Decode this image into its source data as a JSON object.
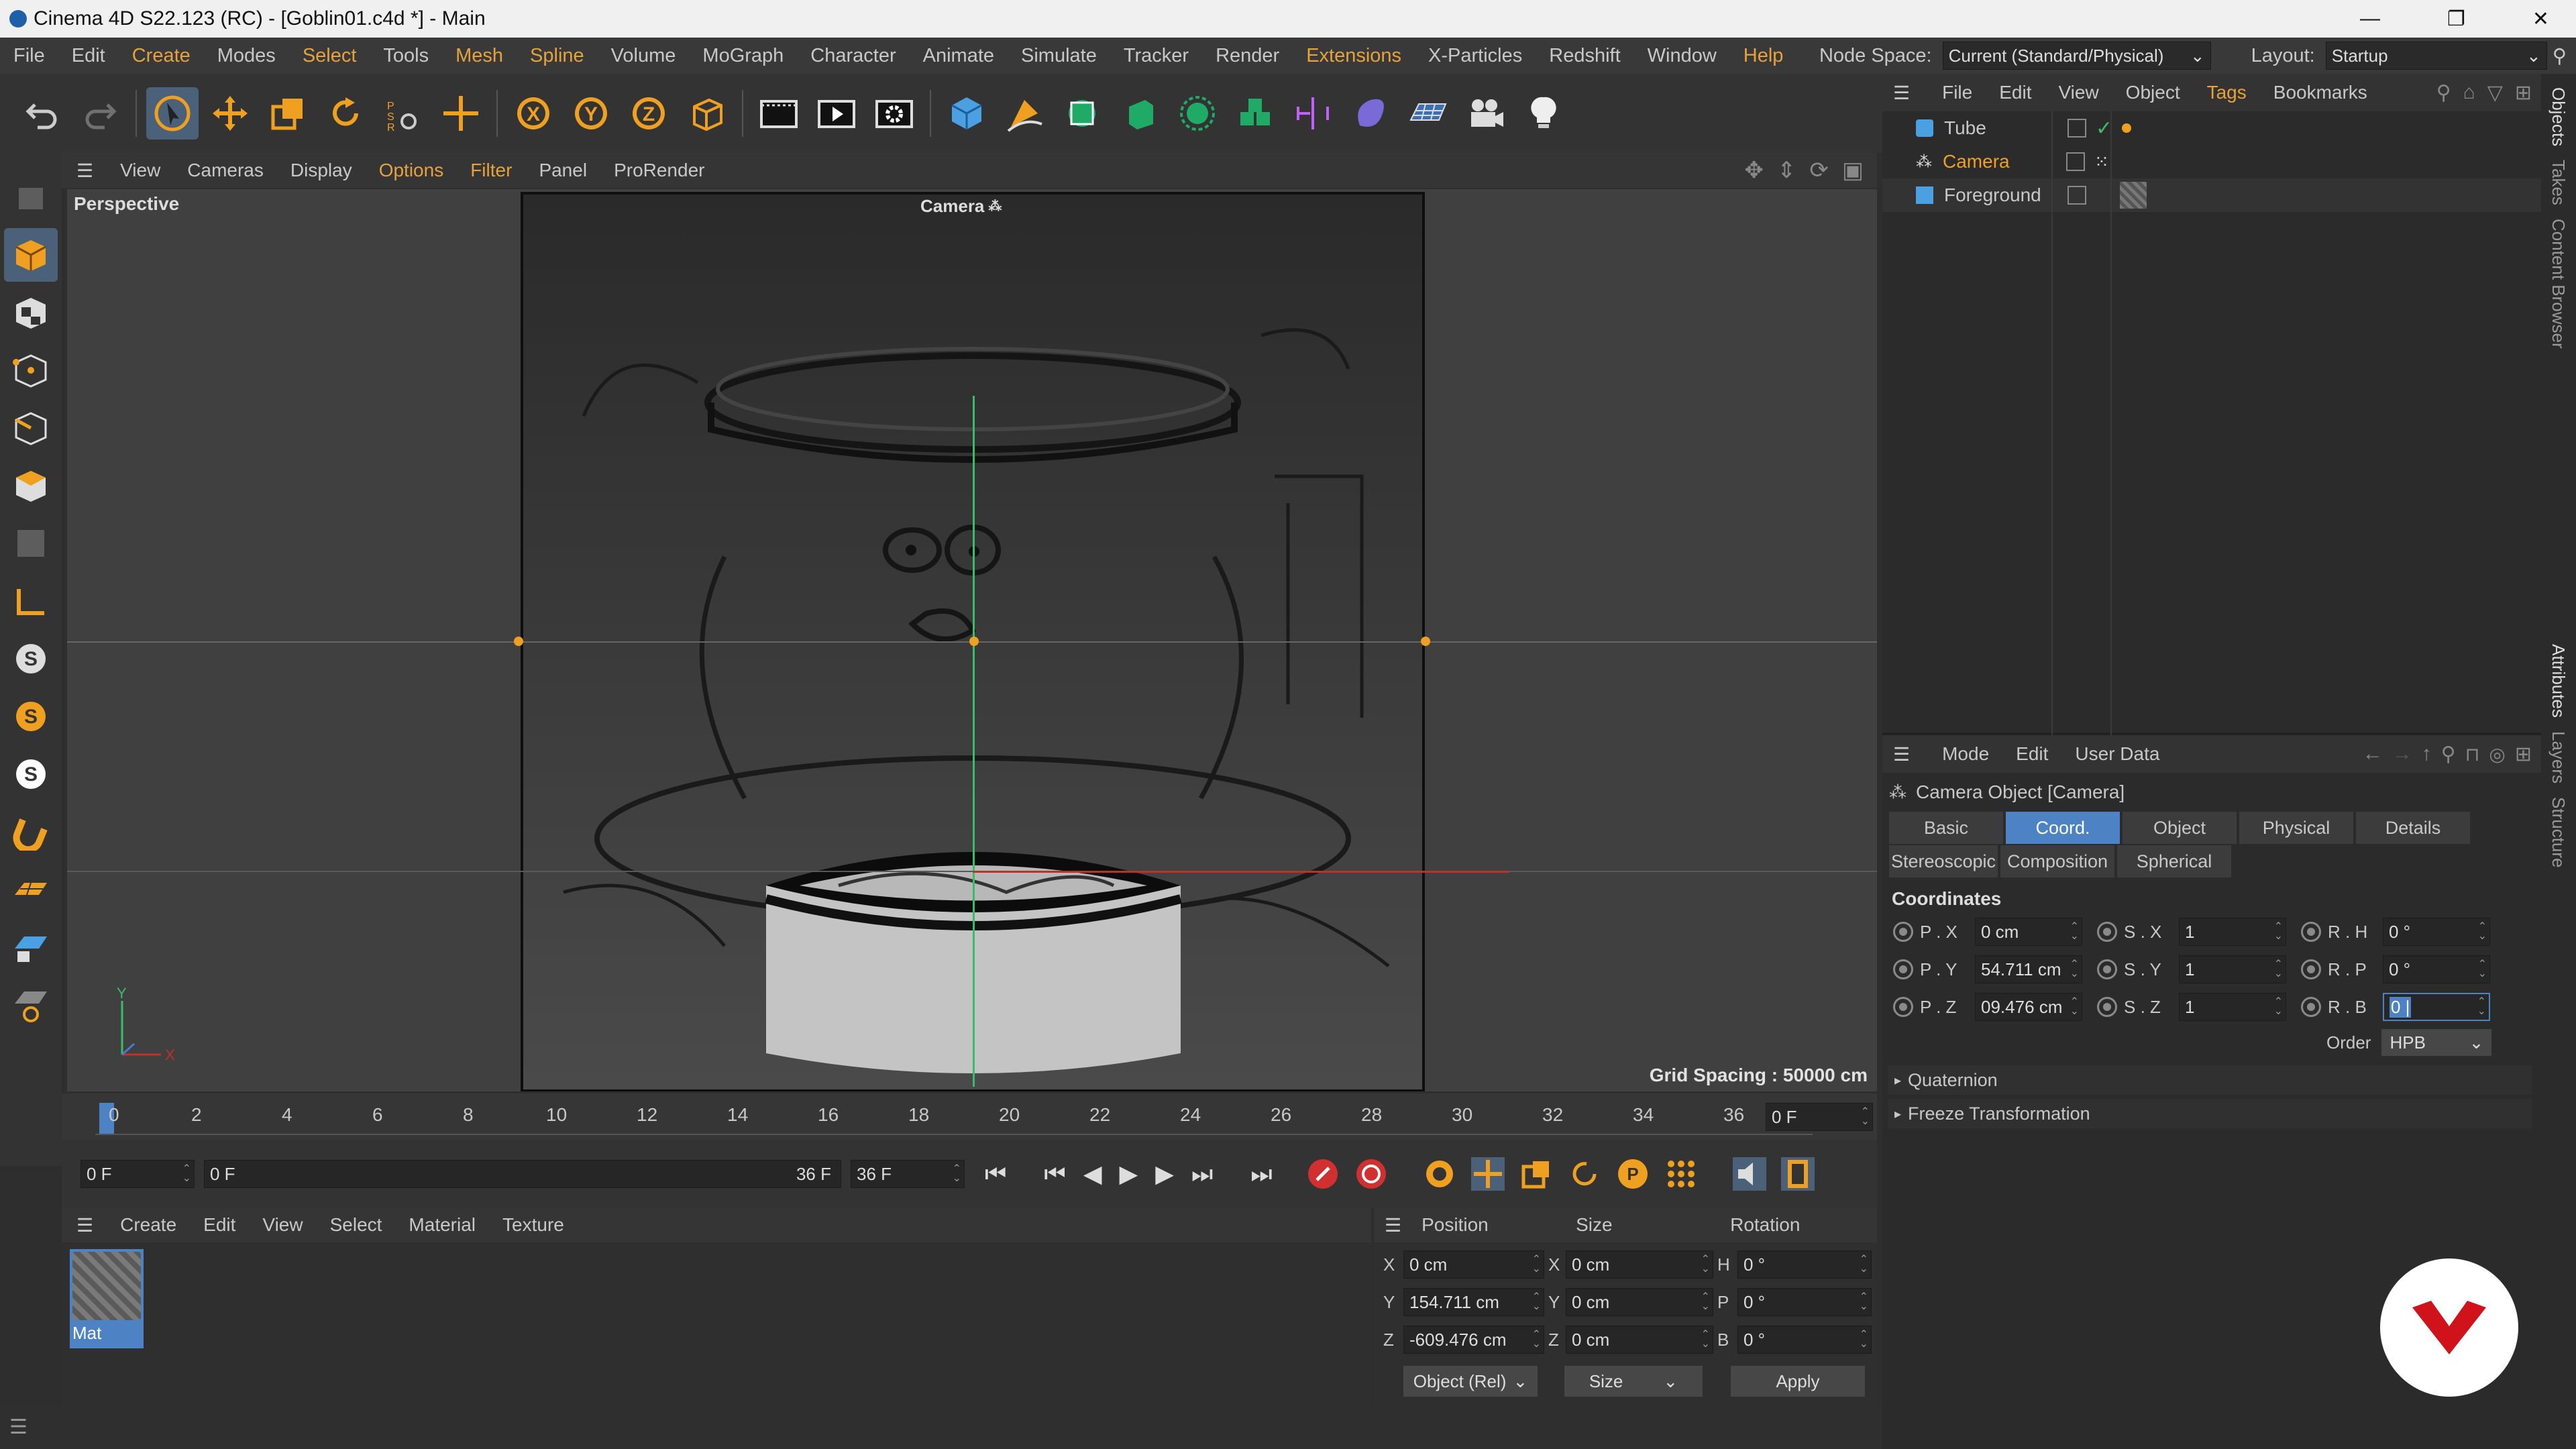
{
  "titlebar": {
    "title": "Cinema 4D S22.123 (RC) - [Goblin01.c4d *] - Main",
    "min": "—",
    "max": "❐",
    "close": "✕"
  },
  "menu": {
    "items": [
      "File",
      "Edit",
      "Create",
      "Modes",
      "Select",
      "Tools",
      "Mesh",
      "Spline",
      "Volume",
      "MoGraph",
      "Character",
      "Animate",
      "Simulate",
      "Tracker",
      "Render",
      "Extensions",
      "X-Particles",
      "Redshift",
      "Window",
      "Help"
    ],
    "node_space_label": "Node Space:",
    "node_space_value": "Current (Standard/Physical)",
    "layout_label": "Layout:",
    "layout_value": "Startup"
  },
  "toolbar": {
    "icons": [
      "undo-icon",
      "redo-icon",
      "select-icon",
      "move-icon",
      "scale-icon",
      "rotate-icon",
      "psr-icon",
      "world-axis-icon",
      "x-axis-icon",
      "y-axis-icon",
      "z-axis-icon",
      "coordinate-system-icon",
      "render-view-icon",
      "render-picture-viewer-icon",
      "render-settings-icon",
      "cube-icon",
      "pen-icon",
      "subdivision-icon",
      "extrude-icon",
      "cloner-icon",
      "instance-icon",
      "symmetry-icon",
      "deformer-icon",
      "floor-icon",
      "camera-icon",
      "light-icon"
    ]
  },
  "viewport": {
    "menu": [
      "View",
      "Cameras",
      "Display",
      "Options",
      "Filter",
      "Panel",
      "ProRender"
    ],
    "label": "Perspective",
    "camera_label": "Camera",
    "grid_spacing": "Grid Spacing : 50000 cm",
    "axis_x": "X",
    "axis_y": "Y"
  },
  "timeline": {
    "ticks": [
      "0",
      "2",
      "4",
      "6",
      "8",
      "10",
      "12",
      "14",
      "16",
      "18",
      "20",
      "22",
      "24",
      "26",
      "28",
      "30",
      "32",
      "34",
      "36"
    ],
    "frame_field": "0 F"
  },
  "transport": {
    "start_frame": "0 F",
    "range_start": "0 F",
    "range_end": "36 F",
    "end_frame": "36 F"
  },
  "materials": {
    "menu": [
      "Create",
      "Edit",
      "View",
      "Select",
      "Material",
      "Texture"
    ],
    "items": [
      {
        "name": "Mat"
      }
    ]
  },
  "coords_panel": {
    "headers": [
      "Position",
      "Size",
      "Rotation"
    ],
    "rows": [
      {
        "axis": "X",
        "pos": "0 cm",
        "size_axis": "X",
        "size": "0 cm",
        "rot_axis": "H",
        "rot": "0 °"
      },
      {
        "axis": "Y",
        "pos": "154.711 cm",
        "size_axis": "Y",
        "size": "0 cm",
        "rot_axis": "P",
        "rot": "0 °"
      },
      {
        "axis": "Z",
        "pos": "-609.476 cm",
        "size_axis": "Z",
        "size": "0 cm",
        "rot_axis": "B",
        "rot": "0 °"
      }
    ],
    "mode_select": "Object (Rel)",
    "size_select": "Size",
    "apply": "Apply"
  },
  "object_manager": {
    "menu": [
      "File",
      "Edit",
      "View",
      "Object",
      "Tags",
      "Bookmarks"
    ],
    "objects": [
      {
        "name": "Tube",
        "selected": false
      },
      {
        "name": "Camera",
        "selected": true
      },
      {
        "name": "Foreground",
        "selected": false
      }
    ]
  },
  "attributes": {
    "menu": [
      "Mode",
      "Edit",
      "User Data"
    ],
    "title": "Camera Object [Camera]",
    "tabs_row1": [
      "Basic",
      "Coord.",
      "Object",
      "Physical",
      "Details"
    ],
    "tabs_row2": [
      "Stereoscopic",
      "Composition",
      "Spherical"
    ],
    "active_tab": "Coord.",
    "section": "Coordinates",
    "fields": [
      {
        "p_label": "P . X",
        "p_val": "0 cm",
        "s_label": "S . X",
        "s_val": "1",
        "r_label": "R . H",
        "r_val": "0 °"
      },
      {
        "p_label": "P . Y",
        "p_val": "54.711 cm",
        "s_label": "S . Y",
        "s_val": "1",
        "r_label": "R . P",
        "r_val": "0 °"
      },
      {
        "p_label": "P . Z",
        "p_val": "09.476 cm",
        "s_label": "S . Z",
        "s_val": "1",
        "r_label": "R . B",
        "r_val": "0 |"
      }
    ],
    "order_label": "Order",
    "order_value": "HPB",
    "groups": [
      "Quaternion",
      "Freeze Transformation"
    ]
  },
  "side_tabs": {
    "top": [
      "Objects",
      "Takes",
      "Content Browser"
    ],
    "bottom": [
      "Attributes",
      "Layers",
      "Structure"
    ]
  },
  "colors": {
    "accent": "#e6a23c",
    "selection_blue": "#4d82c4",
    "logo_red": "#d0121b"
  }
}
